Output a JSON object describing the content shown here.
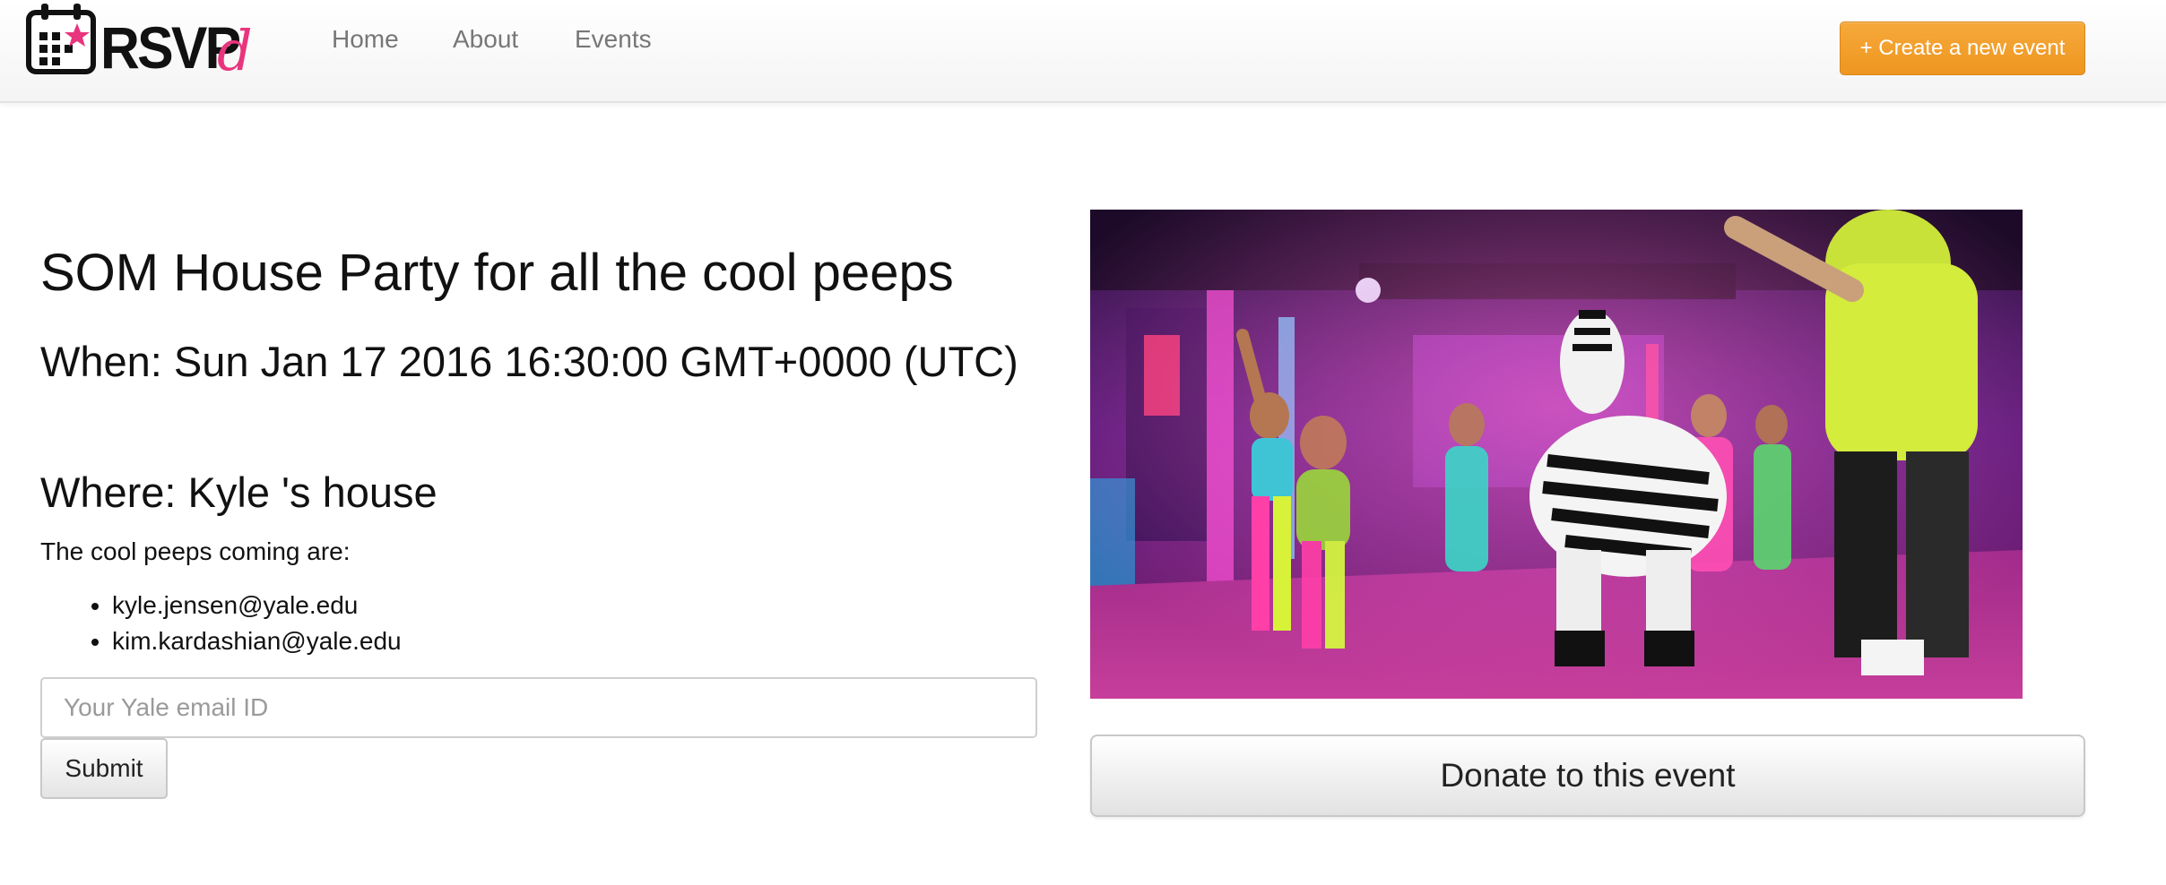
{
  "navbar": {
    "brand_text": "RSVP",
    "brand_suffix": "d",
    "links": [
      {
        "label": "Home"
      },
      {
        "label": "About"
      },
      {
        "label": "Events"
      }
    ],
    "create_button_label": "+ Create a new event",
    "create_button_color": "#f0a030"
  },
  "event": {
    "title": "SOM House Party for all the cool peeps",
    "when": "When: Sun Jan 17 2016 16:30:00 GMT+0000 (UTC)",
    "where": "Where: Kyle 's house",
    "attendees_label": "The cool peeps coming are:",
    "attendees": [
      "kyle.jensen@yale.edu",
      "kim.kardashian@yale.edu"
    ]
  },
  "rsvp_form": {
    "email_placeholder": "Your Yale email ID",
    "email_value": "",
    "submit_label": "Submit"
  },
  "media": {
    "image_subject": "party-photo-dancers-with-zebra-costume"
  },
  "donate": {
    "button_label": "Donate to this event"
  },
  "colors": {
    "brand_accent": "#e8357d",
    "nav_link": "#777777",
    "create_button": "#f0a030"
  }
}
